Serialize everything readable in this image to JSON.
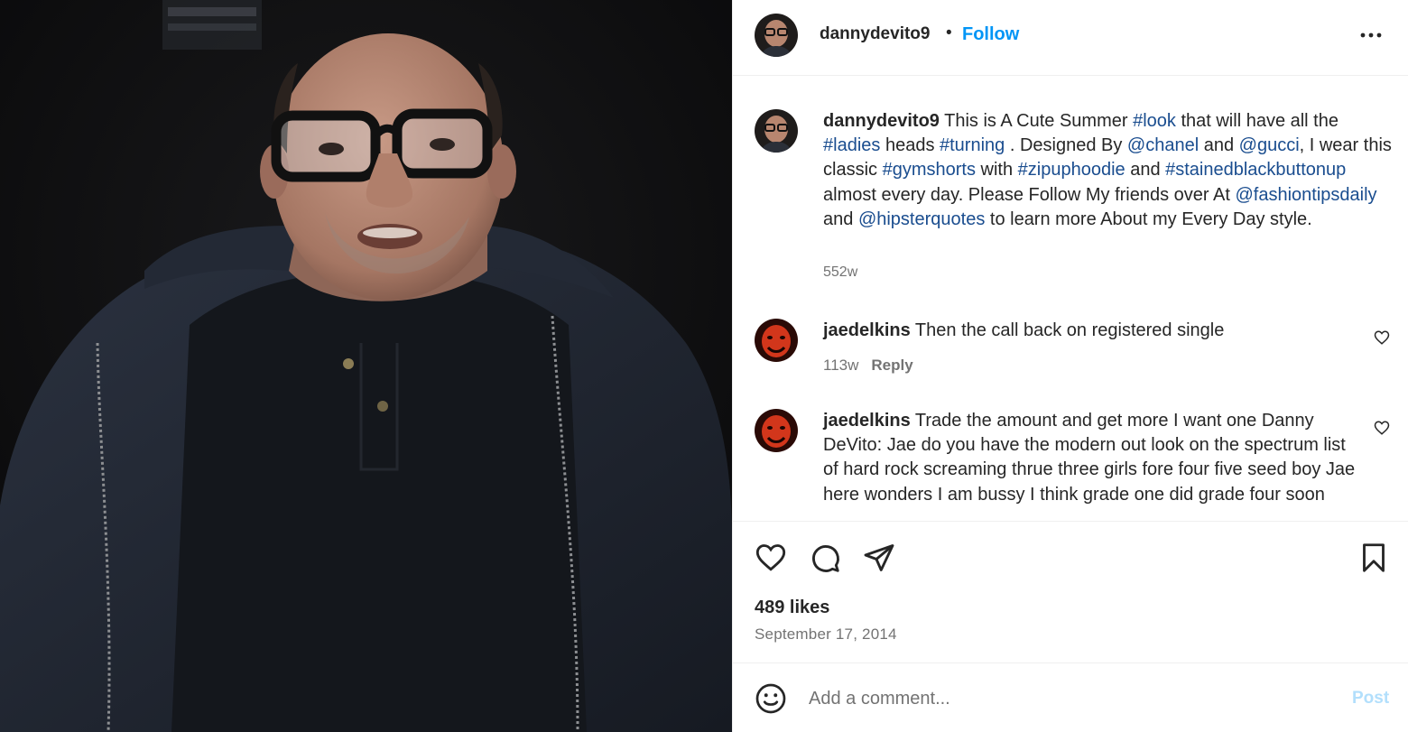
{
  "post": {
    "username": "dannydevito9",
    "separator": "•",
    "follow_label": "Follow",
    "more_icon": "more-horizontal-icon"
  },
  "caption": {
    "username": "dannydevito9",
    "parts": [
      {
        "t": " This is A Cute Summer ",
        "k": "text"
      },
      {
        "t": "#look",
        "k": "tag"
      },
      {
        "t": " that will have all the ",
        "k": "text"
      },
      {
        "t": "#ladies",
        "k": "tag"
      },
      {
        "t": " heads ",
        "k": "text"
      },
      {
        "t": "#turning",
        "k": "tag"
      },
      {
        "t": " . Designed By ",
        "k": "text"
      },
      {
        "t": "@chanel",
        "k": "tag"
      },
      {
        "t": " and ",
        "k": "text"
      },
      {
        "t": "@gucci",
        "k": "tag"
      },
      {
        "t": ", I wear this classic ",
        "k": "text"
      },
      {
        "t": "#gymshorts",
        "k": "tag"
      },
      {
        "t": " with ",
        "k": "text"
      },
      {
        "t": "#zipuphoodie",
        "k": "tag"
      },
      {
        "t": " and ",
        "k": "text"
      },
      {
        "t": "#stainedblackbuttonup",
        "k": "tag"
      },
      {
        "t": " almost every day. Please Follow My friends over At ",
        "k": "text"
      },
      {
        "t": "@fashiontipsdaily",
        "k": "tag"
      },
      {
        "t": " and ",
        "k": "text"
      },
      {
        "t": "@hipsterquotes",
        "k": "tag"
      },
      {
        "t": " to learn more About my Every Day style.",
        "k": "text"
      }
    ],
    "time": "552w"
  },
  "comments": [
    {
      "username": "jaedelkins",
      "text": "Then the call back on registered single",
      "time": "113w",
      "reply_label": "Reply"
    },
    {
      "username": "jaedelkins",
      "text": "Trade the amount and get more I want one Danny DeVito: Jae do you have the modern out look on the spectrum list of hard rock screaming thrue three girls fore four five seed boy Jae here wonders I am bussy I think grade one did grade four soon"
    }
  ],
  "actions": {
    "icons": [
      "heart-icon",
      "comment-icon",
      "share-icon",
      "bookmark-icon"
    ],
    "likes": "489 likes",
    "date": "September 17, 2014"
  },
  "composer": {
    "placeholder": "Add a comment...",
    "post_label": "Post",
    "emoji_icon": "emoji-icon"
  },
  "colors": {
    "link": "#0095f6",
    "tag": "#1a4d8f",
    "muted": "#737373",
    "post_disabled": "#b2dffc"
  }
}
